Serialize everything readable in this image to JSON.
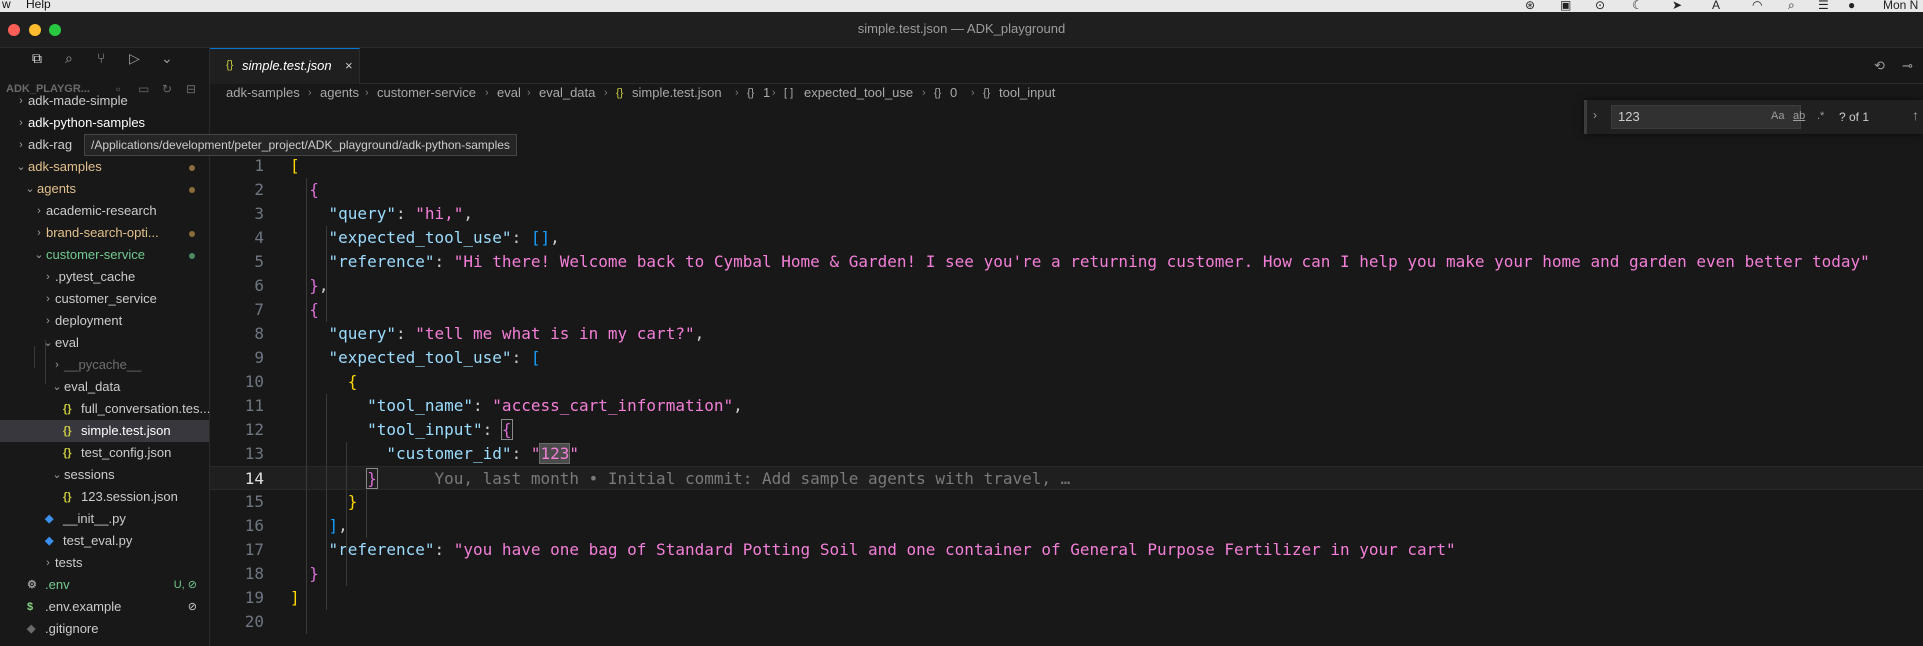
{
  "menubar": {
    "left_partial": "w",
    "help": "Help",
    "right_partial": "Mon N"
  },
  "window": {
    "title": "simple.test.json — ADK_playground"
  },
  "sidebar": {
    "explorer_label": "ADK_PLAYGR...",
    "tooltip": "/Applications/development/peter_project/ADK_playground/adk-python-samples",
    "items": [
      {
        "label": "adk-made-simple",
        "chev": "›",
        "icon": "",
        "color": "#cccccc",
        "dot": ""
      },
      {
        "label": "adk-python-samples",
        "chev": "›",
        "icon": "",
        "color": "#ffffff",
        "dot": ""
      },
      {
        "label": "adk-rag",
        "chev": "›",
        "icon": "",
        "color": "#cccccc",
        "dot": ""
      },
      {
        "label": "adk-samples",
        "chev": "⌄",
        "icon": "",
        "color": "#e2c08d",
        "dot": "#8a6d3b"
      },
      {
        "label": "agents",
        "chev": "⌄",
        "icon": "",
        "color": "#e2c08d",
        "dot": "#8a6d3b"
      },
      {
        "label": "academic-research",
        "chev": "›",
        "icon": "",
        "color": "#cccccc",
        "dot": ""
      },
      {
        "label": "brand-search-opti...",
        "chev": "›",
        "icon": "",
        "color": "#e2c08d",
        "dot": "#8a6d3b"
      },
      {
        "label": "customer-service",
        "chev": "⌄",
        "icon": "",
        "color": "#73c991",
        "dot": "#4e8a5e"
      },
      {
        "label": ".pytest_cache",
        "chev": "›",
        "icon": "",
        "color": "#cccccc",
        "dot": ""
      },
      {
        "label": "customer_service",
        "chev": "›",
        "icon": "",
        "color": "#cccccc",
        "dot": ""
      },
      {
        "label": "deployment",
        "chev": "›",
        "icon": "",
        "color": "#cccccc",
        "dot": ""
      },
      {
        "label": "eval",
        "chev": "⌄",
        "icon": "",
        "color": "#cccccc",
        "dot": ""
      },
      {
        "label": "__pycache__",
        "chev": "›",
        "icon": "",
        "color": "#6e6e6e",
        "dot": ""
      },
      {
        "label": "eval_data",
        "chev": "⌄",
        "icon": "",
        "color": "#cccccc",
        "dot": ""
      },
      {
        "label": "full_conversation.tes...",
        "chev": "",
        "icon": "{}",
        "color": "#cccccc",
        "dot": ""
      },
      {
        "label": "simple.test.json",
        "chev": "",
        "icon": "{}",
        "color": "#ffffff",
        "dot": ""
      },
      {
        "label": "test_config.json",
        "chev": "",
        "icon": "{}",
        "color": "#cccccc",
        "dot": ""
      },
      {
        "label": "sessions",
        "chev": "⌄",
        "icon": "",
        "color": "#cccccc",
        "dot": ""
      },
      {
        "label": "123.session.json",
        "chev": "",
        "icon": "{}",
        "color": "#cccccc",
        "dot": ""
      },
      {
        "label": "__init__.py",
        "chev": "",
        "icon": "py",
        "color": "#cccccc",
        "dot": ""
      },
      {
        "label": "test_eval.py",
        "chev": "",
        "icon": "py",
        "color": "#cccccc",
        "dot": ""
      },
      {
        "label": "tests",
        "chev": "›",
        "icon": "",
        "color": "#cccccc",
        "dot": ""
      },
      {
        "label": ".env",
        "chev": "",
        "icon": "⚙",
        "color": "#73c991",
        "git": "U, ⊘"
      },
      {
        "label": ".env.example",
        "chev": "",
        "icon": "$",
        "color": "#cccccc",
        "git": "⊘"
      },
      {
        "label": ".gitignore",
        "chev": "",
        "icon": "◆",
        "color": "#cccccc",
        "dot": ""
      }
    ]
  },
  "tab": {
    "icon": "{}",
    "name": "simple.test.json",
    "close": "×"
  },
  "breadcrumb": [
    {
      "icon": "",
      "label": "adk-samples"
    },
    {
      "icon": "",
      "label": "agents"
    },
    {
      "icon": "",
      "label": "customer-service"
    },
    {
      "icon": "",
      "label": "eval"
    },
    {
      "icon": "",
      "label": "eval_data"
    },
    {
      "icon": "{}",
      "label": "simple.test.json"
    },
    {
      "icon": "{}",
      "label": "1"
    },
    {
      "icon": "[ ]",
      "label": "expected_tool_use"
    },
    {
      "icon": "{}",
      "label": "0"
    },
    {
      "icon": "{}",
      "label": "tool_input"
    }
  ],
  "find": {
    "value": "123",
    "opt_case": "Aa",
    "opt_word": "ab",
    "opt_regex": ".*",
    "count": "? of 1"
  },
  "editor": {
    "current_line": 14,
    "blame": "You, last month • Initial commit: Add sample agents with travel, …",
    "lines": [
      [
        [
          "b1",
          "["
        ]
      ],
      [
        [
          "p",
          "  "
        ],
        [
          "b2",
          "{"
        ]
      ],
      [
        [
          "p",
          "    "
        ],
        [
          "k",
          "\"query\""
        ],
        [
          "p",
          ": "
        ],
        [
          "s",
          "\"hi,\""
        ],
        [
          "p",
          ","
        ]
      ],
      [
        [
          "p",
          "    "
        ],
        [
          "k",
          "\"expected_tool_use\""
        ],
        [
          "p",
          ": "
        ],
        [
          "b3",
          "[]"
        ],
        [
          "p",
          ","
        ]
      ],
      [
        [
          "p",
          "    "
        ],
        [
          "k",
          "\"reference\""
        ],
        [
          "p",
          ": "
        ],
        [
          "s",
          "\"Hi there! Welcome back to Cymbal Home & Garden! I see you're a returning customer. How can I help you make your home and garden even better today\""
        ]
      ],
      [
        [
          "p",
          "  "
        ],
        [
          "b2",
          "}"
        ],
        [
          "p",
          ","
        ]
      ],
      [
        [
          "p",
          "  "
        ],
        [
          "b2",
          "{"
        ]
      ],
      [
        [
          "p",
          "    "
        ],
        [
          "k",
          "\"query\""
        ],
        [
          "p",
          ": "
        ],
        [
          "s",
          "\"tell me what is in my cart?\""
        ],
        [
          "p",
          ","
        ]
      ],
      [
        [
          "p",
          "    "
        ],
        [
          "k",
          "\"expected_tool_use\""
        ],
        [
          "p",
          ": "
        ],
        [
          "b3",
          "["
        ]
      ],
      [
        [
          "p",
          "      "
        ],
        [
          "b1",
          "{"
        ]
      ],
      [
        [
          "p",
          "        "
        ],
        [
          "k",
          "\"tool_name\""
        ],
        [
          "p",
          ": "
        ],
        [
          "s",
          "\"access_cart_information\""
        ],
        [
          "p",
          ","
        ]
      ],
      [
        [
          "p",
          "        "
        ],
        [
          "k",
          "\"tool_input\""
        ],
        [
          "p",
          ": "
        ],
        [
          "b2 bracket-box",
          "{"
        ]
      ],
      [
        [
          "p",
          "          "
        ],
        [
          "k",
          "\"customer_id\""
        ],
        [
          "p",
          ": "
        ],
        [
          "s",
          "\""
        ],
        [
          "s find-hl",
          "123"
        ],
        [
          "s",
          "\""
        ]
      ],
      [
        [
          "p",
          "        "
        ],
        [
          "b2 bracket-box",
          "}"
        ],
        [
          "p",
          "      "
        ],
        [
          "blame",
          "@BLAME@"
        ]
      ],
      [
        [
          "p",
          "      "
        ],
        [
          "b1",
          "}"
        ]
      ],
      [
        [
          "p",
          "    "
        ],
        [
          "b3",
          "]"
        ],
        [
          "p",
          ","
        ]
      ],
      [
        [
          "p",
          "    "
        ],
        [
          "k",
          "\"reference\""
        ],
        [
          "p",
          ": "
        ],
        [
          "s",
          "\"you have one bag of Standard Potting Soil and one container of General Purpose Fertilizer in your cart\""
        ]
      ],
      [
        [
          "p",
          "  "
        ],
        [
          "b2",
          "}"
        ]
      ],
      [
        [
          "b1",
          "]"
        ]
      ],
      []
    ]
  }
}
